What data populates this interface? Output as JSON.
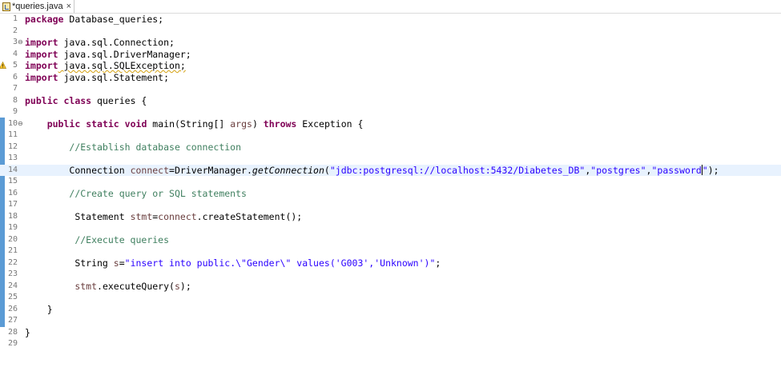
{
  "tab": {
    "title": "*queries.java",
    "close": "×",
    "icon": "java-file-icon"
  },
  "colors": {
    "keyword": "#7f0055",
    "comment": "#3f7f5f",
    "string": "#2a00ff",
    "current_line": "#e8f2fe",
    "change_bar": "#5b9bd5"
  },
  "lines": [
    {
      "n": "1"
    },
    {
      "n": "2"
    },
    {
      "n": "3"
    },
    {
      "n": "4"
    },
    {
      "n": "5"
    },
    {
      "n": "6"
    },
    {
      "n": "7"
    },
    {
      "n": "8"
    },
    {
      "n": "9"
    },
    {
      "n": "10"
    },
    {
      "n": "11"
    },
    {
      "n": "12"
    },
    {
      "n": "13"
    },
    {
      "n": "14"
    },
    {
      "n": "15"
    },
    {
      "n": "16"
    },
    {
      "n": "17"
    },
    {
      "n": "18"
    },
    {
      "n": "19"
    },
    {
      "n": "20"
    },
    {
      "n": "21"
    },
    {
      "n": "22"
    },
    {
      "n": "23"
    },
    {
      "n": "24"
    },
    {
      "n": "25"
    },
    {
      "n": "26"
    },
    {
      "n": "27"
    },
    {
      "n": "28"
    },
    {
      "n": "29"
    }
  ],
  "code": {
    "l1": {
      "kw": "package",
      "rest": " Database_queries;"
    },
    "l3": {
      "kw": "import",
      "rest": " java.sql.Connection;"
    },
    "l4": {
      "kw": "import",
      "rest": " java.sql.DriverManager;"
    },
    "l5": {
      "kw": "import",
      "rest": " java.sql.SQLException;"
    },
    "l6": {
      "kw": "import",
      "rest": " java.sql.Statement;"
    },
    "l8": {
      "kw1": "public",
      "kw2": "class",
      "rest": " queries {"
    },
    "l10": {
      "kw1": "public",
      "kw2": "static",
      "kw3": "void",
      "mid": " main(String[] ",
      "param": "args",
      "mid2": ") ",
      "kw4": "throws",
      "rest": " Exception {"
    },
    "l12": {
      "comment": "//Establish database connection"
    },
    "l14": {
      "pre": "Connection ",
      "var": "connect",
      "mid": "=DriverManager.",
      "method": "getConnection",
      "open": "(",
      "s1": "\"jdbc:postgresql://localhost:5432/Diabetes_DB\"",
      "c1": ",",
      "s2": "\"postgres\"",
      "c2": ",",
      "s3a": "\"password",
      "s3b": "\"",
      "close": ");"
    },
    "l16": {
      "comment": "//Create query or SQL statements"
    },
    "l18": {
      "pre": "Statement ",
      "var": "stmt",
      "mid": "=",
      "var2": "connect",
      "rest": ".createStatement();"
    },
    "l20": {
      "comment": "//Execute queries"
    },
    "l22": {
      "pre": "String ",
      "var": "s",
      "mid": "=",
      "str": "\"insert into public.\\\"Gender\\\" values('G003','Unknown')\"",
      "rest": ";"
    },
    "l24": {
      "var": "stmt",
      "rest": ".executeQuery(",
      "var2": "s",
      "close": ");"
    },
    "l26": {
      "rest": "}"
    },
    "l28": {
      "rest": "}"
    }
  }
}
